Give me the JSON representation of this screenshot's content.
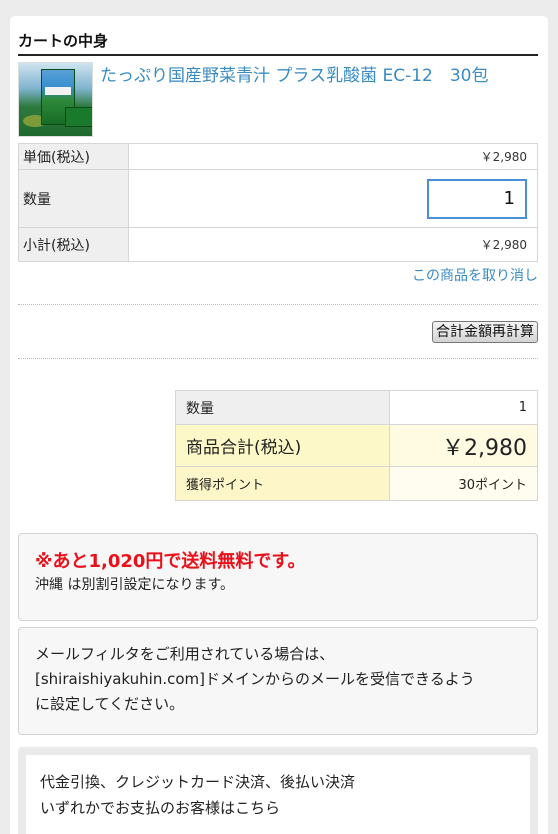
{
  "cart": {
    "title": "カートの中身",
    "product": {
      "name": "たっぷり国産野菜青汁 プラス乳酸菌 EC-12　30包",
      "image_icon": "aojiru-product-image"
    },
    "rows": {
      "unit_price_label": "単価(税込)",
      "unit_price_value": "￥2,980",
      "quantity_label": "数量",
      "quantity_value": "1",
      "subtotal_label": "小計(税込)",
      "subtotal_value": "￥2,980"
    },
    "remove_link": "この商品を取り消し",
    "recalc_button": "合計金額再計算"
  },
  "summary": {
    "quantity_label": "数量",
    "quantity_value": "1",
    "total_label": "商品合計(税込)",
    "total_value": "￥2,980",
    "points_label": "獲得ポイント",
    "points_value": "30ポイント"
  },
  "shipping_notice": {
    "headline": "※あと1,020円で送料無料です。",
    "subtext": "沖縄 は別割引設定になります。"
  },
  "mail_notice": {
    "line1": "メールフィルタをご利用されている場合は、",
    "line2": "[shiraishiyakuhin.com]ドメインからのメールを受信できるよう",
    "line3": "に設定してください。"
  },
  "payment_notice": {
    "line1": "代金引換、クレジットカード決済、後払い決済",
    "line2": "いずれかでお支払のお客様はこちら"
  },
  "colors": {
    "link": "#3a8bc2",
    "alert": "#e8101a",
    "total_bg": "#fdf8c8",
    "input_border": "#4a90d9"
  }
}
